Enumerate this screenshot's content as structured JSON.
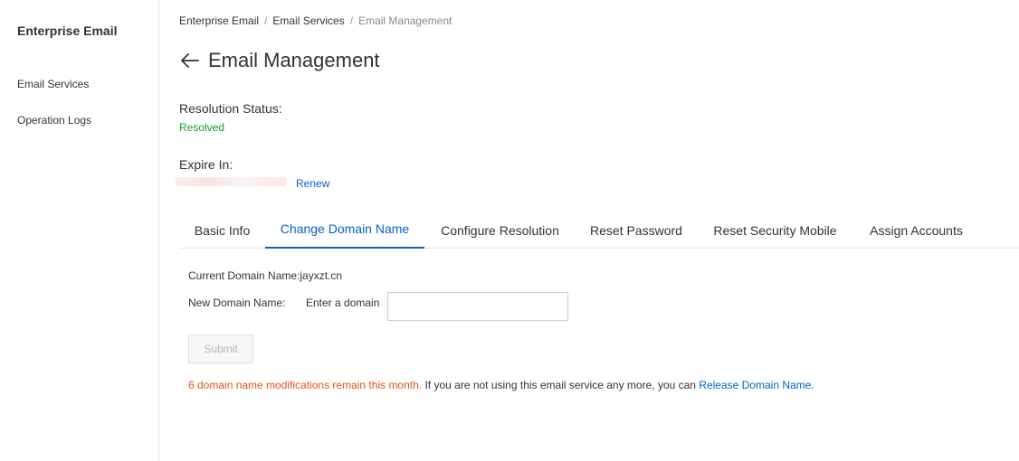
{
  "sidebar": {
    "title": "Enterprise Email",
    "items": [
      {
        "label": "Email Services"
      },
      {
        "label": "Operation Logs"
      }
    ]
  },
  "breadcrumb": {
    "items": [
      "Enterprise Email",
      "Email Services"
    ],
    "separator": "/",
    "current": "Email Management"
  },
  "header": {
    "title": "Email Management",
    "back_icon": "arrow-left-icon"
  },
  "resolution": {
    "label": "Resolution Status:",
    "value": "Resolved",
    "value_color": "#1a9c1a"
  },
  "expire": {
    "label": "Expire In:",
    "renew_label": "Renew"
  },
  "tabs": [
    {
      "label": "Basic Info",
      "active": false
    },
    {
      "label": "Change Domain Name",
      "active": true
    },
    {
      "label": "Configure Resolution",
      "active": false
    },
    {
      "label": "Reset Password",
      "active": false
    },
    {
      "label": "Reset Security Mobile",
      "active": false
    },
    {
      "label": "Assign Accounts",
      "active": false
    }
  ],
  "form": {
    "current_domain_label": "Current Domain Name:",
    "current_domain_value": "jayxzt.cn",
    "new_domain_label": "New Domain Name:",
    "new_domain_hint": "Enter a domain",
    "new_domain_value": "",
    "submit_label": "Submit"
  },
  "notice": {
    "warning": "6 domain name modifications remain this month.",
    "text": " If you are not using this email service any more, you can ",
    "link": "Release Domain Name",
    "end": "."
  },
  "colors": {
    "accent": "#0064c8",
    "success": "#1a9c1a",
    "warning": "#e8501c"
  }
}
